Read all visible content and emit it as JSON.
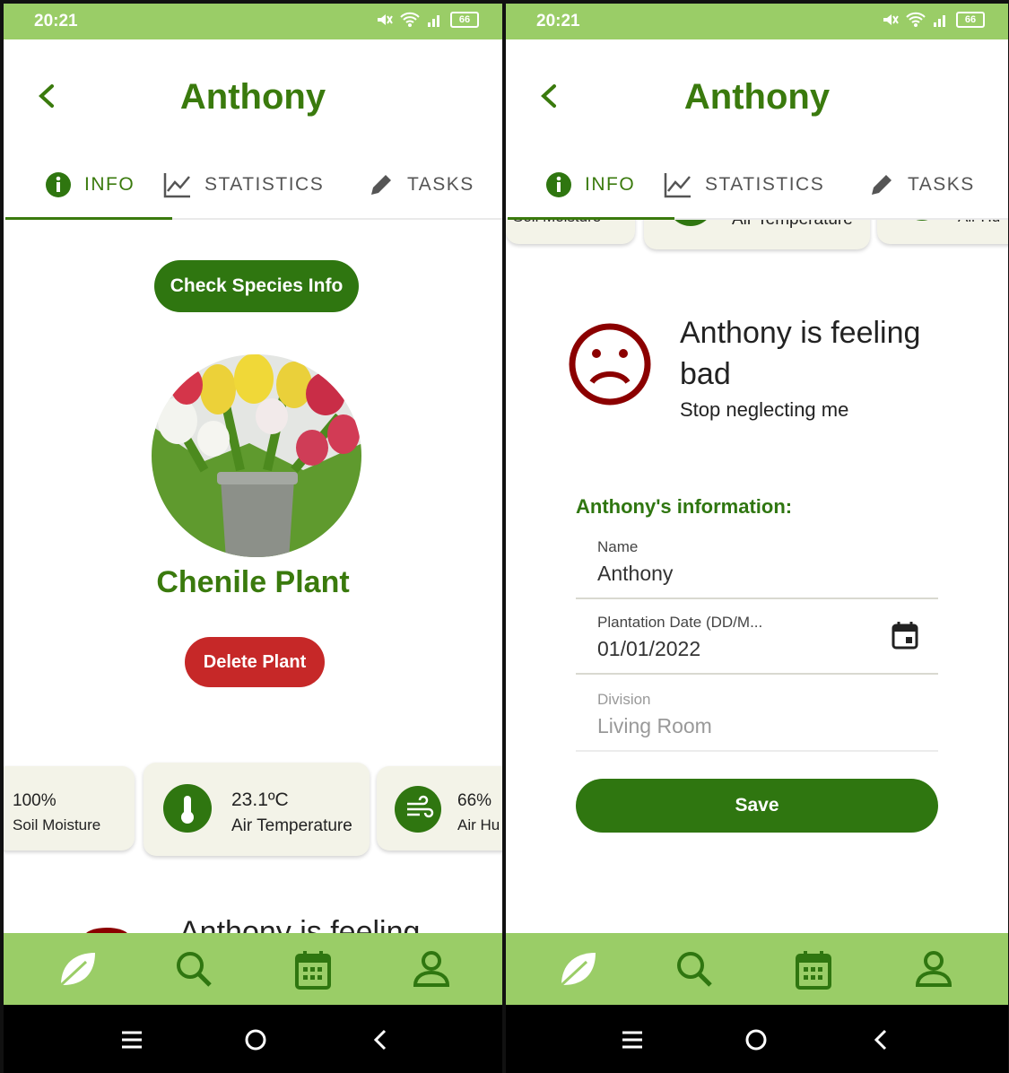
{
  "status": {
    "time": "20:21",
    "battery": "66"
  },
  "header": {
    "title": "Anthony"
  },
  "tabs": [
    {
      "label": "INFO",
      "icon": "info-icon"
    },
    {
      "label": "STATISTICS",
      "icon": "chart-line-icon"
    },
    {
      "label": "TASKS",
      "icon": "pencil-icon"
    }
  ],
  "left": {
    "check_species_label": "Check Species Info",
    "plant_name": "Chenile Plant",
    "delete_label": "Delete Plant",
    "sensors": [
      {
        "value": "100%",
        "label": "Soil Moisture"
      },
      {
        "value": "23.1ºC",
        "label": "Air Temperature",
        "icon": "thermometer-icon"
      },
      {
        "value": "66%",
        "label": "Air Hu",
        "icon": "wind-icon"
      }
    ],
    "peek_text": "Anthony is feeling"
  },
  "right": {
    "peek_cards": [
      "Soil Moisture",
      "Air Temperature",
      "Air Hu"
    ],
    "mood_title_line1": "Anthony is feeling",
    "mood_title_line2": "bad",
    "mood_sub": "Stop neglecting me",
    "info_heading": "Anthony's information:",
    "fields": [
      {
        "label": "Name",
        "value": "Anthony"
      },
      {
        "label": "Plantation Date (DD/M...",
        "value": "01/01/2022"
      },
      {
        "label": "Division",
        "value": "Living Room"
      }
    ],
    "save_label": "Save"
  },
  "colors": {
    "primary": "#2f7610",
    "accent": "#9acd67",
    "title": "#3a7a0d",
    "danger": "#c62828",
    "mood": "#8b0000"
  }
}
